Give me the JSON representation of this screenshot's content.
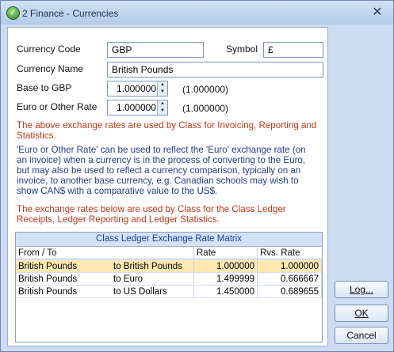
{
  "window": {
    "title": "2 Finance - Currencies",
    "close_glyph": "✕"
  },
  "form": {
    "currency_code_label": "Currency Code",
    "currency_code_value": "GBP",
    "symbol_label": "Symbol",
    "symbol_value": "£",
    "currency_name_label": "Currency Name",
    "currency_name_value": "British Pounds",
    "base_label": "Base to GBP",
    "base_value": "1.000000",
    "base_paren": "(1.000000)",
    "euro_label": "Euro or Other Rate",
    "euro_value": "1.000000",
    "euro_paren": "(1.000000)"
  },
  "notes": {
    "note1": "The above exchange rates are used by Class for Invoicing, Reporting and Statistics.",
    "note2": "'Euro or Other Rate' can be used to reflect the 'Euro' exchange rate (on an invoice) when a currency is in the process of converting to the Euro, but may also be used to reflect a currency comparison, typically on an invoice, to another base currency, e.g. Canadian schools may wish to show CAN$ with a comparative value to the US$.",
    "note3": "The exchange rates below are used by Class for the Class Ledger Receipts, Ledger Reporting and Ledger Statistics."
  },
  "matrix": {
    "caption": "Class Ledger Exchange Rate Matrix",
    "headers": [
      "From / To",
      "Rate",
      "Rvs. Rate"
    ],
    "rows": [
      {
        "from": "British Pounds",
        "to": "to British Pounds",
        "rate": "1.000000",
        "rvs": "1.000000"
      },
      {
        "from": "British Pounds",
        "to": "to Euro",
        "rate": "1.499999",
        "rvs": "0.666667"
      },
      {
        "from": "British Pounds",
        "to": "to US Dollars",
        "rate": "1.450000",
        "rvs": "0.689655"
      }
    ]
  },
  "buttons": {
    "log": "Log...",
    "ok": "OK",
    "cancel": "Cancel"
  },
  "colors": {
    "note_red": "#c0391b",
    "note_blue": "#253a8c",
    "selected_row": "#fde8b2"
  }
}
